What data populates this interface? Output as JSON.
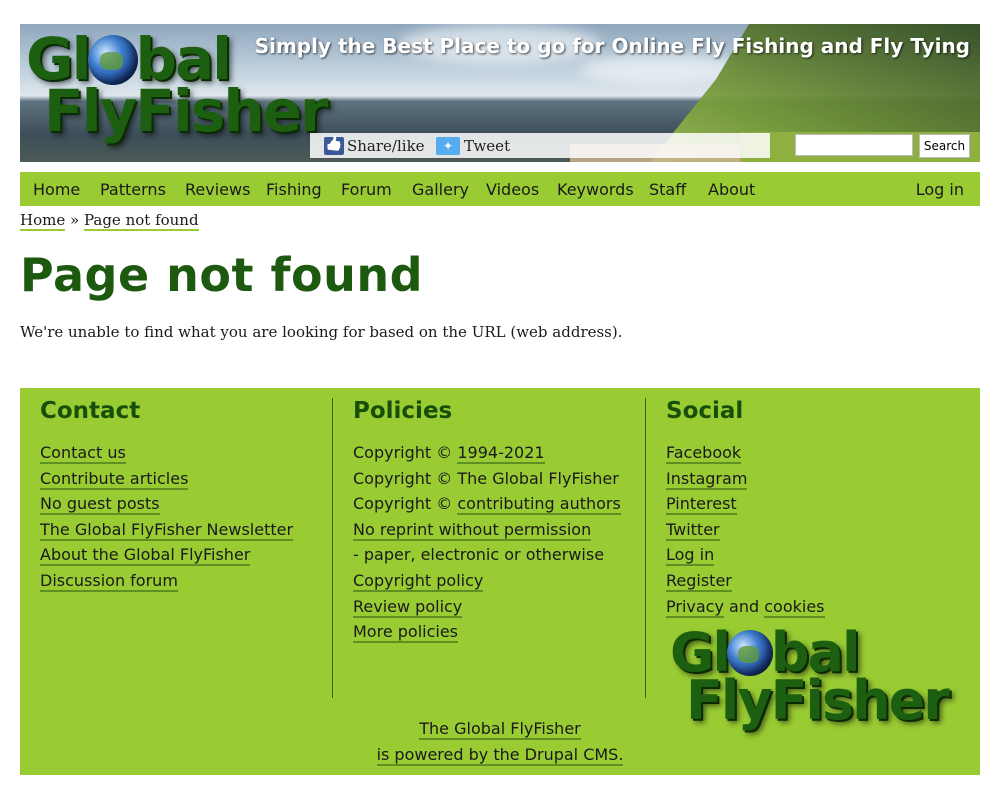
{
  "header": {
    "logo_line1_a": "Gl",
    "logo_line1_b": "bal",
    "logo_line2": "FlyFisher",
    "tagline": "Simply the Best Place to go for Online Fly Fishing and Fly Tying",
    "share_label": "Share/like",
    "tweet_label": "Tweet",
    "search_value": "",
    "search_button": "Search"
  },
  "nav": {
    "items": [
      "Home",
      "Patterns",
      "Reviews",
      "Fishing",
      "Forum",
      "Gallery",
      "Videos",
      "Keywords",
      "Staff",
      "About"
    ],
    "login": "Log in"
  },
  "breadcrumb": {
    "home": "Home",
    "separator": "»",
    "current": "Page not found"
  },
  "main": {
    "title": "Page not found",
    "message": "We're unable to find what you are looking for based on the URL (web address)."
  },
  "footer": {
    "contact": {
      "heading": "Contact",
      "links": [
        "Contact us",
        "Contribute articles",
        "No guest posts",
        "The Global FlyFisher Newsletter",
        "About the Global FlyFisher",
        "Discussion forum"
      ]
    },
    "policies": {
      "heading": "Policies",
      "copyright_prefix": "Copyright ©",
      "years": "1994-2021",
      "copyright_owner": "The Global FlyFisher",
      "authors": "contributing authors",
      "no_reprint": "No reprint without permission",
      "reprint_note": "- paper, electronic or otherwise",
      "copyright_policy": "Copyright policy",
      "review_policy": "Review policy",
      "more_policies": "More policies"
    },
    "social": {
      "heading": "Social",
      "links": [
        "Facebook",
        "Instagram",
        "Pinterest",
        "Twitter",
        "Log in",
        "Register"
      ],
      "privacy": "Privacy",
      "and": "and",
      "cookies": "cookies"
    },
    "credit_line1": "The Global FlyFisher",
    "credit_line2": "is powered by the Drupal CMS."
  }
}
